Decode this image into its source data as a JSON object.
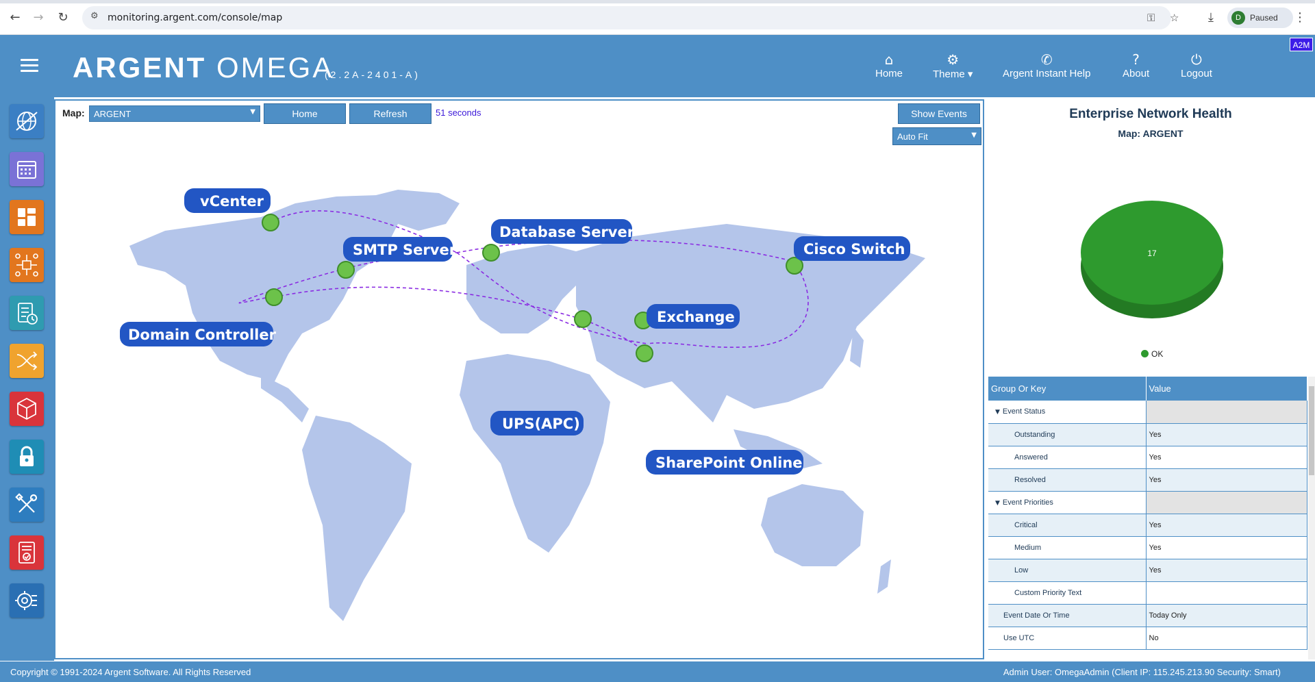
{
  "browser": {
    "url": "monitoring.argent.com/console/map",
    "profile_initial": "D",
    "profile_status": "Paused"
  },
  "header": {
    "title_bold": "ARGENT",
    "title_light": "OMEGA",
    "version": "(2.2A-2401-A)",
    "badge": "A2M",
    "nav": [
      {
        "label": "Home",
        "icon": "home-icon"
      },
      {
        "label": "Theme ▾",
        "icon": "gear-icon"
      },
      {
        "label": "Argent Instant Help",
        "icon": "phone-icon"
      },
      {
        "label": "About",
        "icon": "question-icon"
      },
      {
        "label": "Logout",
        "icon": "power-icon"
      }
    ]
  },
  "sidebar": {
    "items": [
      {
        "icon": "globe-network-icon",
        "color": "#3b7fc4"
      },
      {
        "icon": "calendar-icon",
        "color": "#7a72d6"
      },
      {
        "icon": "dashboard-tiles-icon",
        "color": "#e2761e"
      },
      {
        "icon": "network-nodes-icon",
        "color": "#e2761e"
      },
      {
        "icon": "checklist-clock-icon",
        "color": "#2f9bb0"
      },
      {
        "icon": "switch-arrows-icon",
        "color": "#f0a32e"
      },
      {
        "icon": "cube-icon",
        "color": "#d9343b"
      },
      {
        "icon": "lock-icon",
        "color": "#1f8db5"
      },
      {
        "icon": "tools-icon",
        "color": "#2e7dbf"
      },
      {
        "icon": "report-check-icon",
        "color": "#d9343b"
      },
      {
        "icon": "gear-circuit-icon",
        "color": "#2a6fb3"
      }
    ]
  },
  "map_toolbar": {
    "map_label": "Map:",
    "map_value": "ARGENT",
    "home_button": "Home",
    "refresh_button": "Refresh",
    "seconds": "51 seconds",
    "show_events_button": "Show Events",
    "autofit_value": "Auto Fit"
  },
  "map_nodes": [
    {
      "label": "vCenter"
    },
    {
      "label": "SMTP Server"
    },
    {
      "label": "Database Server"
    },
    {
      "label": "Cisco Switch"
    },
    {
      "label": "Exchange"
    },
    {
      "label": "Domain Controller"
    },
    {
      "label": "UPS(APC)"
    },
    {
      "label": "SharePoint Online"
    }
  ],
  "health": {
    "title": "Enterprise Network Health",
    "subtitle": "Map: ARGENT",
    "ok_count": "17",
    "legend_ok": "OK",
    "ok_color": "#2e9a2e"
  },
  "properties": {
    "col_key": "Group Or Key",
    "col_value": "Value",
    "rows": [
      {
        "key": "Event Status",
        "value": ""
      },
      {
        "key": "Outstanding",
        "value": "Yes"
      },
      {
        "key": "Answered",
        "value": "Yes"
      },
      {
        "key": "Resolved",
        "value": "Yes"
      },
      {
        "key": "Event Priorities",
        "value": ""
      },
      {
        "key": "Critical",
        "value": "Yes"
      },
      {
        "key": "Medium",
        "value": "Yes"
      },
      {
        "key": "Low",
        "value": "Yes"
      },
      {
        "key": "Custom Priority Text",
        "value": ""
      },
      {
        "key": "Event Date Or Time",
        "value": "Today Only"
      },
      {
        "key": "Use UTC",
        "value": "No"
      }
    ]
  },
  "footer": {
    "copyright": "Copyright © 1991-2024 Argent Software. All Rights Reserved",
    "admin": "Admin User: OmegaAdmin (Client IP: 115.245.213.90 Security: Smart)"
  }
}
